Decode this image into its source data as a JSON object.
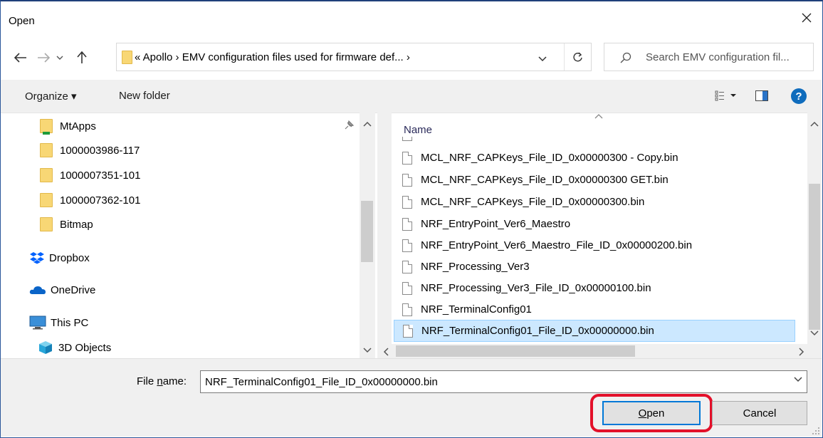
{
  "window": {
    "title": "Open"
  },
  "address": {
    "path_text": "«  Apollo  ›  EMV configuration files used for firmware def...  ›",
    "search_placeholder": "Search EMV configuration fil..."
  },
  "toolbar": {
    "organize_label": "Organize ▾",
    "new_folder_label": "New folder"
  },
  "nav_tree": [
    {
      "label": "MtApps",
      "icon": "pinned-folder-icon"
    },
    {
      "label": "1000003986-117",
      "icon": "folder-icon"
    },
    {
      "label": "1000007351-101",
      "icon": "folder-icon"
    },
    {
      "label": "1000007362-101",
      "icon": "folder-icon"
    },
    {
      "label": "Bitmap",
      "icon": "folder-icon"
    },
    {
      "label": "Dropbox",
      "icon": "dropbox-icon"
    },
    {
      "label": "OneDrive",
      "icon": "onedrive-icon"
    },
    {
      "label": "This PC",
      "icon": "computer-icon"
    },
    {
      "label": "3D Objects",
      "icon": "3d-objects-icon"
    }
  ],
  "file_list": {
    "column_name": "Name",
    "files": [
      "MCL_NRF_CAPKeys_File_ID_0x00000300 - Copy.bin",
      "MCL_NRF_CAPKeys_File_ID_0x00000300 GET.bin",
      "MCL_NRF_CAPKeys_File_ID_0x00000300.bin",
      "NRF_EntryPoint_Ver6_Maestro",
      "NRF_EntryPoint_Ver6_Maestro_File_ID_0x00000200.bin",
      "NRF_Processing_Ver3",
      "NRF_Processing_Ver3_File_ID_0x00000100.bin",
      "NRF_TerminalConfig01",
      "NRF_TerminalConfig01_File_ID_0x00000000.bin"
    ],
    "selected_index": 8
  },
  "footer": {
    "file_name_label_prefix": "File ",
    "file_name_label_underlined": "n",
    "file_name_label_suffix": "ame:",
    "file_name_value": "NRF_TerminalConfig01_File_ID_0x00000000.bin",
    "open_label_underlined": "O",
    "open_label_rest": "pen",
    "cancel_label": "Cancel"
  },
  "colors": {
    "selection": "#cce8ff",
    "highlight_ring": "#e3102a",
    "focus_border": "#0078d7"
  }
}
